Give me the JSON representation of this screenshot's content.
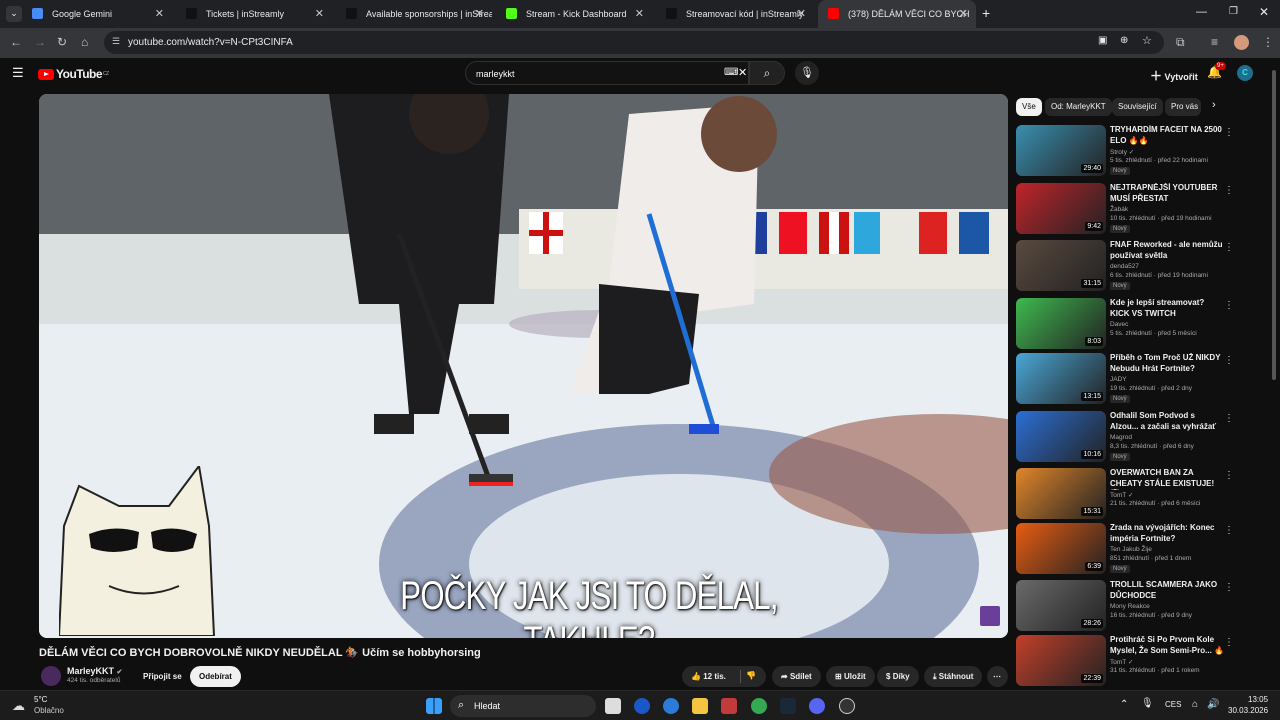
{
  "browser": {
    "tabs": [
      {
        "title": "Google Gemini",
        "color": "#4a8cf7"
      },
      {
        "title": "Tickets | inStreamly",
        "color": "#111111"
      },
      {
        "title": "Available sponsorships | inStrea",
        "color": "#111111"
      },
      {
        "title": "Stream - Kick Dashboard",
        "color": "#53fc18"
      },
      {
        "title": "Streamovací kód | inStreamly",
        "color": "#111111"
      },
      {
        "title": "(378) DĚLÁM VĚCI CO BYCH",
        "color": "#ff0000"
      }
    ],
    "url": "youtube.com/watch?v=N-CPt3CINFA"
  },
  "youtube": {
    "logo": "YouTube",
    "country": "CZ",
    "search_value": "marleykkt",
    "create_label": "Vytvořit",
    "notif_count": "9+"
  },
  "video": {
    "subtitle": "POČKY JAK JSI TO DĚLAL, TAKHLE?",
    "title": "DĚLÁM VĚCI CO BYCH DOBROVOLNĚ NIKDY NEUDĚLAL 🏇 Učím se hobbyhorsing",
    "channel": "MarleyKKT",
    "subscribers": "424 tis. odběratelů",
    "join": "Připojit se",
    "unsubscribe": "Odebírat",
    "likes": "12 tis.",
    "share": "Sdílet",
    "save": "Uložit",
    "thanks": "Díky",
    "download": "Stáhnout"
  },
  "chips": [
    "Vše",
    "Od: MarleyKKT",
    "Související",
    "Pro vás"
  ],
  "recommendations": [
    {
      "title": "TRYHARDÍM FACEIT NA 2500 ELO 🔥🔥",
      "channel": "Stroty ✓",
      "meta": "5 tis. zhlédnutí · před 22 hodinami",
      "badge": "Nový",
      "duration": "29:40",
      "color": "#3a8fb0"
    },
    {
      "title": "NEJTRAPNĚJŠÍ YOUTUBER MUSÍ PŘESTAT",
      "channel": "Žabák",
      "meta": "10 tis. zhlédnutí · před 19 hodinami",
      "badge": "Nový",
      "duration": "9:42",
      "color": "#c0242b"
    },
    {
      "title": "FNAF Reworked - ale nemůžu používat světla",
      "channel": "denda527",
      "meta": "6 tis. zhlédnutí · před 19 hodinami",
      "badge": "Nový",
      "duration": "31:15",
      "color": "#5a4a3e"
    },
    {
      "title": "Kde je lepší streamovat? KICK VS TWITCH",
      "channel": "Davec",
      "meta": "5 tis. zhlédnutí · před 5 měsíci",
      "badge": "",
      "duration": "8:03",
      "color": "#3fb950"
    },
    {
      "title": "Příběh o Tom Proč UŽ NIKDY Nebudu Hrát Fortnite?",
      "channel": "JADY",
      "meta": "19 tis. zhlédnutí · před 2 dny",
      "badge": "Nový",
      "duration": "13:15",
      "color": "#4aa7d8"
    },
    {
      "title": "Odhalil Som Podvod s Alzou... a začali sa vyhrážať",
      "channel": "Magrod",
      "meta": "8,3 tis. zhlédnutí · před 6 dny",
      "badge": "Nový",
      "duration": "10:16",
      "color": "#2b6fd6"
    },
    {
      "title": "OVERWATCH BAN ZA CHEATY STÁLE EXISTUJE! 🤡 - ...",
      "channel": "TomT ✓",
      "meta": "21 tis. zhlédnutí · před 6 měsíci",
      "badge": "",
      "duration": "15:31",
      "color": "#e0862a"
    },
    {
      "title": "Zrada na vývojářích: Konec impéria Fortnite?",
      "channel": "Ten Jakub Žije",
      "meta": "851 zhlédnutí · před 1 dnem",
      "badge": "Nový",
      "duration": "6:39",
      "color": "#e85c12"
    },
    {
      "title": "TROLLIL SCAMMERA JAKO DŮCHODCE",
      "channel": "Mony Reakce",
      "meta": "16 tis. zhlédnutí · před 9 dny",
      "badge": "",
      "duration": "28:26",
      "color": "#6a6a6a"
    },
    {
      "title": "Protihráč Si Po Prvom Kole Myslel, Že Som Semi-Pro... 🔥",
      "channel": "TomT ✓",
      "meta": "31 tis. zhlédnutí · před 1 rokem",
      "badge": "",
      "duration": "22:39",
      "color": "#c2402a"
    }
  ],
  "taskbar": {
    "weather_temp": "5°C",
    "weather_desc": "Oblačno",
    "search_placeholder": "Hledat",
    "lang": "CES",
    "time": "13:05",
    "date": "30.03.2026"
  }
}
